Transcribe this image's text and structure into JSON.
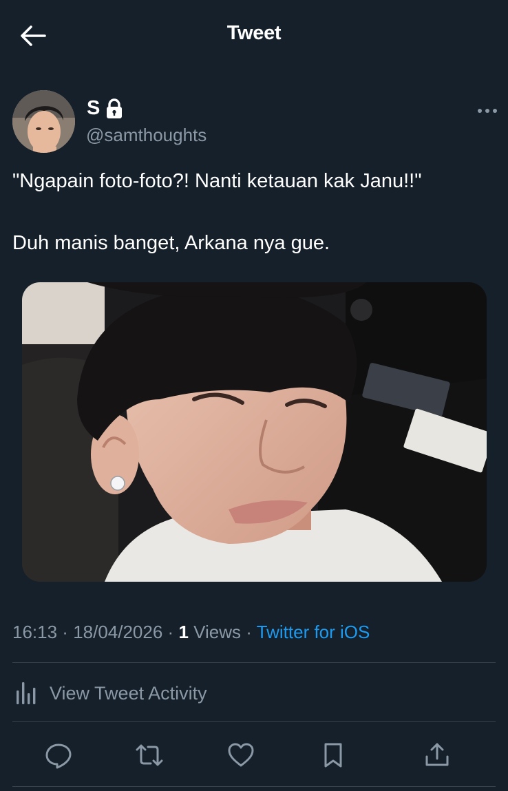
{
  "header": {
    "title": "Tweet",
    "back_icon": "arrow-left-icon"
  },
  "author": {
    "display_name": "S",
    "handle": "@samthoughts",
    "protected_icon": "lock-icon"
  },
  "tweet": {
    "line1": "\"Ngapain foto-foto?! Nanti ketauan kak Janu!!\"",
    "line2": "Duh manis banget, Arkana nya gue."
  },
  "meta": {
    "time": "16:13",
    "separator": " · ",
    "date": "18/04/2026",
    "views_count": "1",
    "views_label": " Views",
    "source": "Twitter for iOS"
  },
  "activity": {
    "label": "View Tweet Activity",
    "icon": "analytics-bars-icon"
  },
  "actions": {
    "reply_icon": "reply-icon",
    "retweet_icon": "retweet-icon",
    "like_icon": "heart-icon",
    "bookmark_icon": "bookmark-icon",
    "share_icon": "share-icon"
  },
  "colors": {
    "background": "#15202b",
    "text": "#ffffff",
    "secondary": "#8b98a5",
    "link": "#1d9bf0",
    "divider": "#38444d"
  }
}
